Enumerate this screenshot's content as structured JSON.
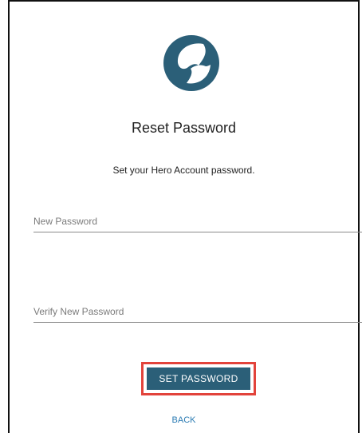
{
  "logo": {
    "icon": "hero-logo-icon",
    "color": "#2b5f78"
  },
  "title": "Reset Password",
  "subtitle": "Set your Hero Account password.",
  "fields": {
    "new_password": {
      "placeholder": "New Password",
      "value": ""
    },
    "verify_password": {
      "placeholder": "Verify New Password",
      "value": ""
    }
  },
  "actions": {
    "set_password_label": "SET PASSWORD",
    "back_label": "BACK"
  },
  "colors": {
    "primary": "#2b5f78",
    "highlight": "#e2433b",
    "link": "#2b7bb3"
  }
}
